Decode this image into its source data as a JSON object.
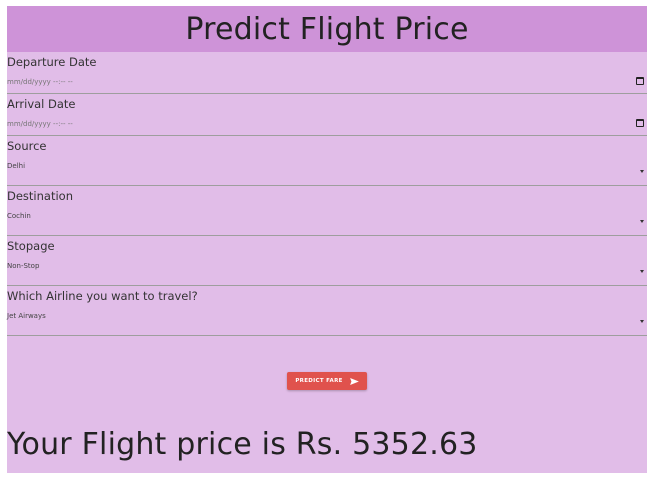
{
  "header": {
    "title": "Predict Flight Price"
  },
  "form": {
    "departure": {
      "label": "Departure Date",
      "placeholder": "mm/dd/yyyy --:-- --"
    },
    "arrival": {
      "label": "Arrival Date",
      "placeholder": "mm/dd/yyyy --:-- --"
    },
    "source": {
      "label": "Source",
      "value": "Delhi"
    },
    "destination": {
      "label": "Destination",
      "value": "Cochin"
    },
    "stopage": {
      "label": "Stopage",
      "value": "Non-Stop"
    },
    "airline": {
      "label": "Which Airline you want to travel?",
      "value": "Jet Airways"
    }
  },
  "button": {
    "label": "PREDICT FARE",
    "icon": "send-icon"
  },
  "result": {
    "text": "Your Flight price is Rs. 5352.63"
  },
  "colors": {
    "page_background": "#e1bde8",
    "header_background": "#ce93d8",
    "button": "#e0524d"
  }
}
